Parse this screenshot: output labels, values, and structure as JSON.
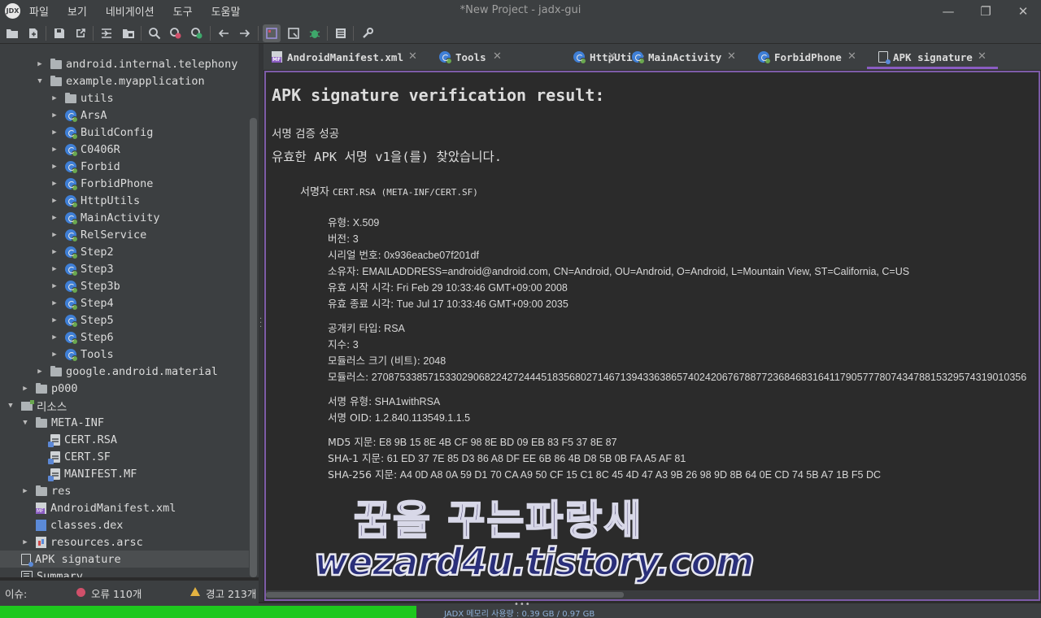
{
  "window": {
    "title": "*New Project - jadx-gui",
    "logo_text": "JDX",
    "minimize": "—",
    "maximize": "❐",
    "close": "✕"
  },
  "menu": [
    "파일",
    "보기",
    "네비게이션",
    "도구",
    "도움말"
  ],
  "tree": [
    {
      "label": "android.internal.telephony",
      "icon": "package-folder-icon",
      "arrow": "▶"
    },
    {
      "label": "example.myapplication",
      "icon": "package-folder-icon",
      "arrow": "▼"
    },
    {
      "label": "utils",
      "icon": "package-folder-icon",
      "arrow": "▶"
    },
    {
      "label": "ArsA",
      "icon": "class-icon",
      "arrow": "▶"
    },
    {
      "label": "BuildConfig",
      "icon": "class-icon",
      "arrow": "▶"
    },
    {
      "label": "C0406R",
      "icon": "class-icon",
      "arrow": "▶"
    },
    {
      "label": "Forbid",
      "icon": "class-icon",
      "arrow": "▶"
    },
    {
      "label": "ForbidPhone",
      "icon": "class-icon",
      "arrow": "▶"
    },
    {
      "label": "HttpUtils",
      "icon": "class-icon",
      "arrow": "▶"
    },
    {
      "label": "MainActivity",
      "icon": "class-icon",
      "arrow": "▶"
    },
    {
      "label": "RelService",
      "icon": "class-icon",
      "arrow": "▶"
    },
    {
      "label": "Step2",
      "icon": "class-icon",
      "arrow": "▶"
    },
    {
      "label": "Step3",
      "icon": "class-icon",
      "arrow": "▶"
    },
    {
      "label": "Step3b",
      "icon": "class-icon",
      "arrow": "▶"
    },
    {
      "label": "Step4",
      "icon": "class-icon",
      "arrow": "▶"
    },
    {
      "label": "Step5",
      "icon": "class-icon",
      "arrow": "▶"
    },
    {
      "label": "Step6",
      "icon": "class-icon",
      "arrow": "▶"
    },
    {
      "label": "Tools",
      "icon": "class-icon",
      "arrow": "▶"
    },
    {
      "label": "google.android.material",
      "icon": "package-folder-icon",
      "arrow": "▶"
    },
    {
      "label": "p000",
      "icon": "package-folder-icon",
      "arrow": "▶"
    },
    {
      "label": "리소스",
      "icon": "resources-folder-icon",
      "arrow": "▼"
    },
    {
      "label": "META-INF",
      "icon": "folder-icon",
      "arrow": "▼"
    },
    {
      "label": "CERT.RSA",
      "icon": "file-icon",
      "arrow": ""
    },
    {
      "label": "CERT.SF",
      "icon": "file-icon",
      "arrow": ""
    },
    {
      "label": "MANIFEST.MF",
      "icon": "file-icon",
      "arrow": ""
    },
    {
      "label": "res",
      "icon": "folder-icon",
      "arrow": "▶"
    },
    {
      "label": "AndroidManifest.xml",
      "icon": "manifest-file-icon",
      "arrow": ""
    },
    {
      "label": "classes.dex",
      "icon": "dex-file-icon",
      "arrow": ""
    },
    {
      "label": "resources.arsc",
      "icon": "arsc-file-icon",
      "arrow": "▶"
    },
    {
      "label": "APK signature",
      "icon": "signature-icon",
      "arrow": ""
    },
    {
      "label": "Summary",
      "icon": "summary-icon",
      "arrow": ""
    }
  ],
  "tabs": [
    {
      "label": "AndroidManifest.xml",
      "icon": "manifest-file-icon"
    },
    {
      "label": "Tools",
      "icon": "class-icon"
    },
    {
      "label": "HttpUtils",
      "icon": "class-icon"
    },
    {
      "label": "MainActivity",
      "icon": "class-icon"
    },
    {
      "label": "ForbidPhone",
      "icon": "class-icon"
    },
    {
      "label": "APK signature",
      "icon": "signature-icon"
    }
  ],
  "tab_close": "✕",
  "content": {
    "heading": "APK signature verification result:",
    "success": "서명 검증 성공",
    "found": "유효한 APK 서명 v1을(를) 찾았습니다.",
    "signer_label": "서명자",
    "signer_value": "CERT.RSA (META-INF/CERT.SF)",
    "fields": [
      {
        "label": "유형:",
        "value": "X.509"
      },
      {
        "label": "버전:",
        "value": "3"
      },
      {
        "label": "시리얼 번호:",
        "value": "0x936eacbe07f201df"
      },
      {
        "label": "소유자:",
        "value": "EMAILADDRESS=android@android.com, CN=Android, OU=Android, O=Android, L=Mountain View, ST=California, C=US"
      },
      {
        "label": "유효 시작 시각:",
        "value": "Fri Feb 29 10:33:46 GMT+09:00 2008"
      },
      {
        "label": "유효 종료 시각:",
        "value": "Tue Jul 17 10:33:46 GMT+09:00 2035"
      },
      {
        "label": "공개키 타입:",
        "value": "RSA"
      },
      {
        "label": "지수:",
        "value": "3"
      },
      {
        "label": "모듈러스 크기 (비트):",
        "value": "2048"
      },
      {
        "label": "모듈러스:",
        "value": "27087533857153302906822427244451835680271467139433638657402420676788772368468316411790577780743478815329574319010356"
      },
      {
        "label": "서명 유형:",
        "value": "SHA1withRSA"
      },
      {
        "label": "서명 OID:",
        "value": "1.2.840.113549.1.1.5"
      },
      {
        "label": "MD5 지문:",
        "value": "E8 9B 15 8E 4B CF 98 8E BD 09 EB 83 F5 37 8E 87"
      },
      {
        "label": "SHA-1 지문:",
        "value": "61 ED 37 7E 85 D3 86 A8 DF EE 6B 86 4B D8 5B 0B FA A5 AF 81"
      },
      {
        "label": "SHA-256 지문:",
        "value": "A4 0D A8 0A 59 D1 70 CA A9 50 CF 15 C1 8C 45 4D 47 A3 9B 26 98 9D 8B 64 0E CD 74 5B A7 1B F5 DC"
      }
    ]
  },
  "watermark": {
    "korean": "꿈을 꾸는파랑새",
    "url": "wezard4u.tistory.com"
  },
  "issues": {
    "label": "이슈:",
    "errors": "오류 110개",
    "warnings": "경고 213개"
  },
  "status": {
    "memory": "JADX 메모리 사용량 : 0.39 GB / 0.97 GB",
    "memory_fraction": 0.4,
    "dots": "•••"
  },
  "colors": {
    "accent": "#8a5cc2",
    "memory_bar": "#1ec81e",
    "error": "#d0506a",
    "warning": "#e3b341"
  }
}
